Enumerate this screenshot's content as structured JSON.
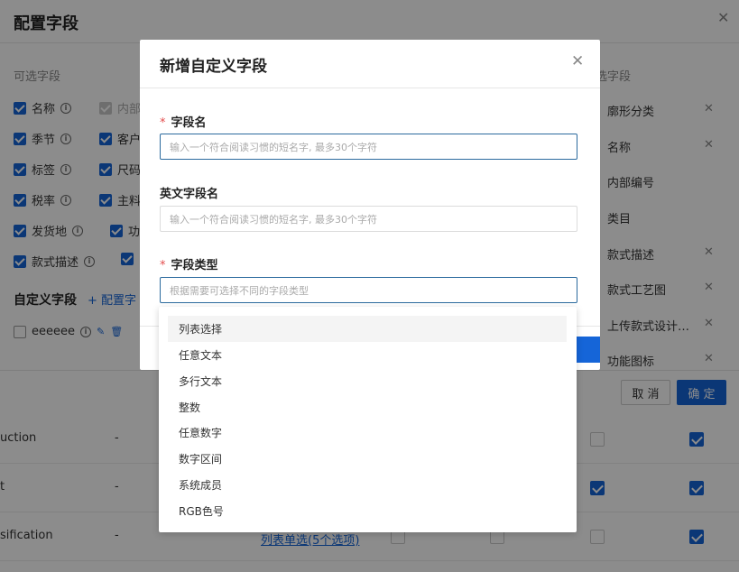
{
  "config_panel": {
    "title": "配置字段",
    "available_title": "可选字段",
    "selected_title": "选字段",
    "available_items": [
      {
        "label": "名称",
        "checked": true,
        "info": true
      },
      {
        "label": "内部",
        "checked": true,
        "disabled": true,
        "info": false
      },
      {
        "label": "季节",
        "checked": true,
        "info": true
      },
      {
        "label": "客户",
        "checked": true,
        "info": false
      },
      {
        "label": "标签",
        "checked": true,
        "info": true
      },
      {
        "label": "尺码",
        "checked": true,
        "info": false
      },
      {
        "label": "税率",
        "checked": true,
        "info": true
      },
      {
        "label": "主料",
        "checked": true,
        "info": false
      },
      {
        "label": "发货地",
        "checked": true,
        "info": true
      },
      {
        "label": "功",
        "checked": true,
        "info": false
      },
      {
        "label": "款式描述",
        "checked": true,
        "info": true
      },
      {
        "label": "",
        "checked": true,
        "info": false
      }
    ],
    "custom_title": "自定义字段",
    "custom_config_link": "+ 配置字",
    "custom_items": [
      {
        "label": "eeeeee",
        "checked": false
      }
    ],
    "selected_items": [
      {
        "label": "廓形分类",
        "removable": true
      },
      {
        "label": "名称",
        "removable": true
      },
      {
        "label": "内部编号",
        "removable": false
      },
      {
        "label": "类目",
        "removable": false
      },
      {
        "label": "款式描述",
        "removable": true
      },
      {
        "label": "款式工艺图",
        "removable": true
      },
      {
        "label": "上传款式设计…",
        "removable": true
      },
      {
        "label": "功能图标",
        "removable": true
      }
    ],
    "cancel_label": "取 消",
    "ok_label": "确 定"
  },
  "bg_table": {
    "rows": [
      {
        "name": "uction",
        "dash": "-",
        "col_a": "",
        "check_a": false,
        "check_b": true
      },
      {
        "name": "t",
        "dash": "-",
        "col_a": "",
        "check_a": true,
        "check_b": true
      },
      {
        "name": "sification",
        "dash": "-",
        "col_a": "列表单选(5个选项)",
        "check_a": false,
        "check_b": true
      }
    ]
  },
  "modal": {
    "title": "新增自定义字段",
    "fields": [
      {
        "label": "字段名",
        "required": true,
        "placeholder": "输入一个符合阅读习惯的短名字, 最多30个字符",
        "focused": true
      },
      {
        "label": "英文字段名",
        "required": false,
        "placeholder": "输入一个符合阅读习惯的短名字, 最多30个字符",
        "focused": false
      },
      {
        "label": "字段类型",
        "required": true,
        "placeholder": "根据需要可选择不同的字段类型",
        "focused": true
      }
    ],
    "dropdown_options": [
      "列表选择",
      "任意文本",
      "多行文本",
      "整数",
      "任意数字",
      "数字区间",
      "系统成员",
      "RGB色号"
    ],
    "highlighted_option": 0
  },
  "icons": {
    "close": "close-icon",
    "info": "info-icon",
    "edit": "edit-icon",
    "delete": "delete-icon",
    "remove": "remove-icon"
  },
  "colors": {
    "primary": "#1565d8",
    "required": "#e34d4d",
    "overlay": "rgba(0,0,0,0.45)"
  }
}
